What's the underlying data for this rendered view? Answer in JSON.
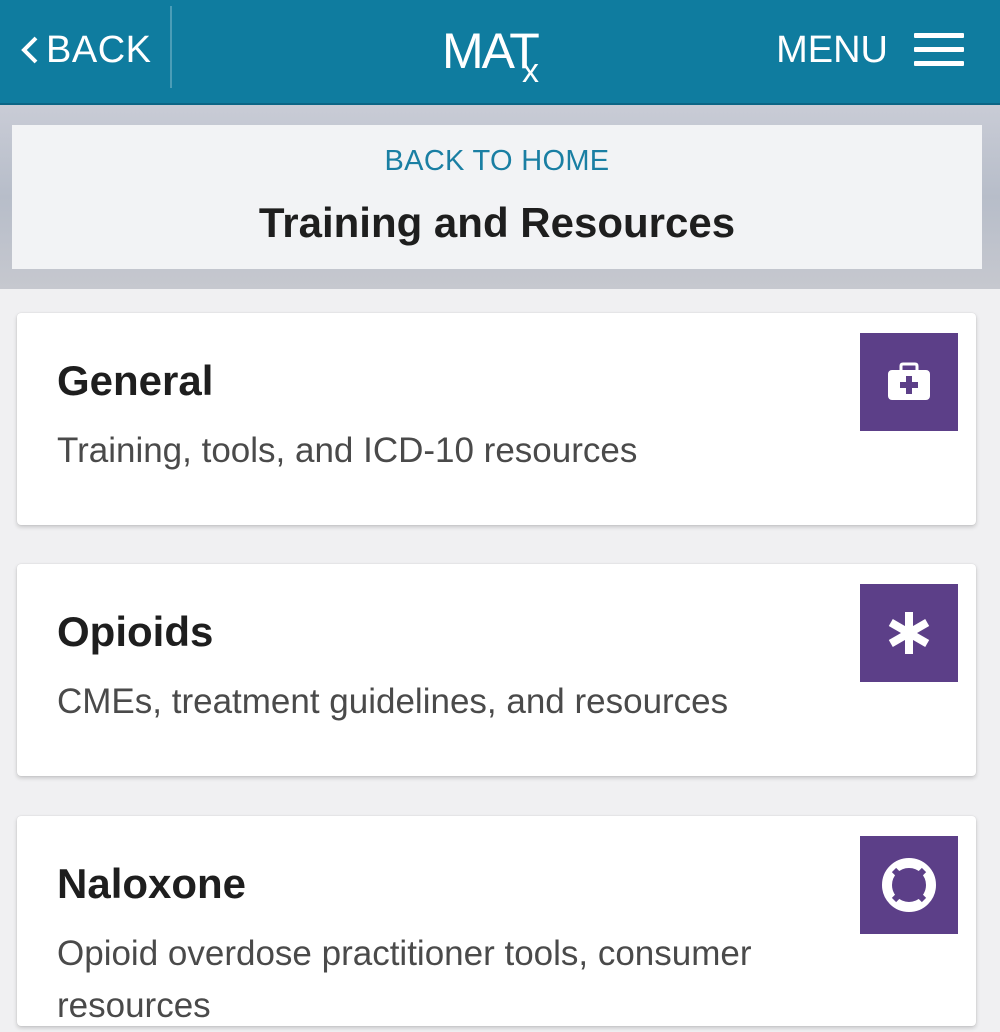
{
  "header": {
    "back_label": "BACK",
    "logo_text": "MAT",
    "logo_sub": "x",
    "menu_label": "MENU",
    "background": "#0f7c9f"
  },
  "hero": {
    "back_home_label": "BACK TO HOME",
    "title": "Training and Resources"
  },
  "cards": [
    {
      "title": "General",
      "description": "Training, tools, and ICD-10 resources",
      "icon": "briefcase-medical-icon"
    },
    {
      "title": "Opioids",
      "description": "CMEs, treatment guidelines, and resources",
      "icon": "asterisk-icon"
    },
    {
      "title": "Naloxone",
      "description": "Opioid overdose practitioner tools, consumer resources",
      "icon": "life-ring-icon"
    }
  ],
  "colors": {
    "accent": "#0f7c9f",
    "icon_bg": "#5c3f88",
    "link": "#1a7fa3"
  }
}
